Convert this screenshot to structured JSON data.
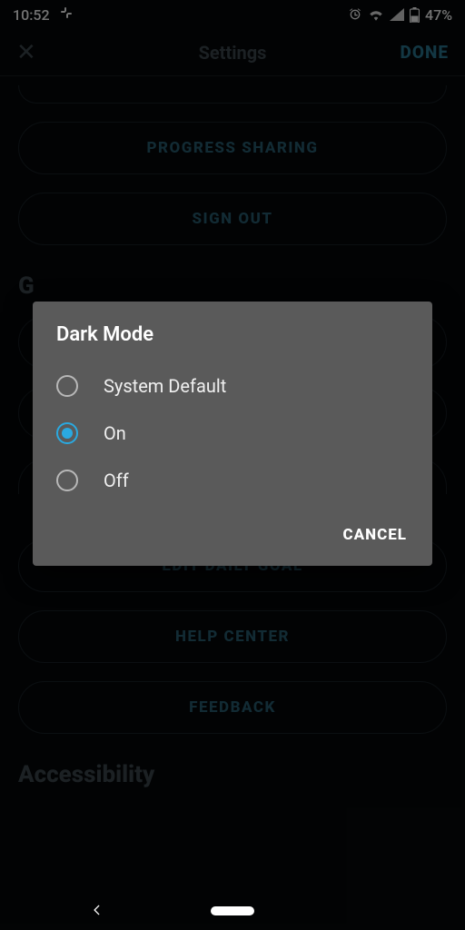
{
  "status": {
    "time": "10:52",
    "battery_pct": "47%"
  },
  "header": {
    "title": "Settings",
    "done_label": "DONE"
  },
  "buttons": {
    "progress_sharing": "PROGRESS SHARING",
    "sign_out": "SIGN OUT",
    "edit_daily_goal": "EDIT DAILY GOAL",
    "help_center": "HELP CENTER",
    "feedback": "FEEDBACK"
  },
  "sections": {
    "partial_letter": "G",
    "accessibility": "Accessibility"
  },
  "dialog": {
    "title": "Dark Mode",
    "options": {
      "system_default": "System Default",
      "on": "On",
      "off": "Off"
    },
    "selected": "on",
    "cancel_label": "CANCEL"
  },
  "colors": {
    "accent": "#2aa9e0",
    "dim_text": "#3f4a50",
    "button_text": "#295f74"
  }
}
